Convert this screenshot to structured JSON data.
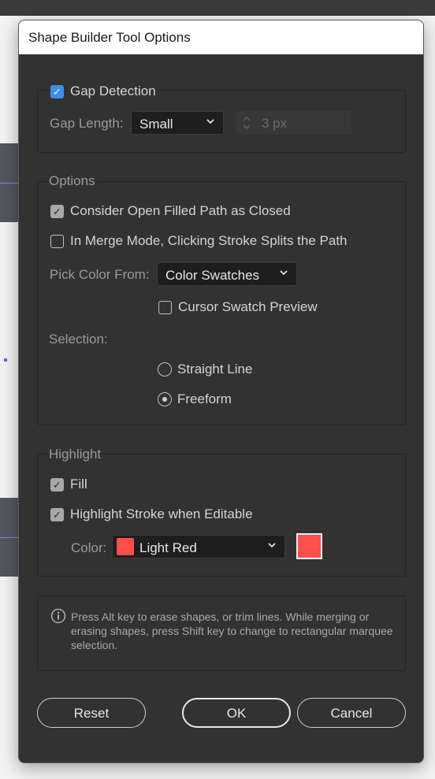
{
  "dialog": {
    "title": "Shape Builder Tool Options"
  },
  "gap_detection": {
    "checkbox_label": "Gap Detection",
    "checked": true,
    "length_label": "Gap Length:",
    "length_value": "Small",
    "length_px_value": "3 px"
  },
  "options": {
    "group_label": "Options",
    "open_filled_label": "Consider Open Filled Path as Closed",
    "open_filled_checked": true,
    "merge_stroke_label": "In Merge Mode, Clicking Stroke Splits the Path",
    "merge_stroke_checked": false,
    "pick_color_label": "Pick Color From:",
    "pick_color_value": "Color Swatches",
    "cursor_preview_label": "Cursor Swatch Preview",
    "cursor_preview_checked": false,
    "selection_label": "Selection:",
    "straight_line_label": "Straight Line",
    "freeform_label": "Freeform",
    "selected_mode": "Freeform"
  },
  "highlight": {
    "group_label": "Highlight",
    "fill_label": "Fill",
    "fill_checked": true,
    "stroke_label": "Highlight Stroke when Editable",
    "stroke_checked": true,
    "color_label": "Color:",
    "color_value": "Light Red",
    "color_hex": "#ff4e4e"
  },
  "info": {
    "text": "Press Alt key to erase shapes, or trim lines. While merging or erasing shapes, press Shift key to change to rectangular marquee selection."
  },
  "buttons": {
    "reset": "Reset",
    "ok": "OK",
    "cancel": "Cancel"
  }
}
